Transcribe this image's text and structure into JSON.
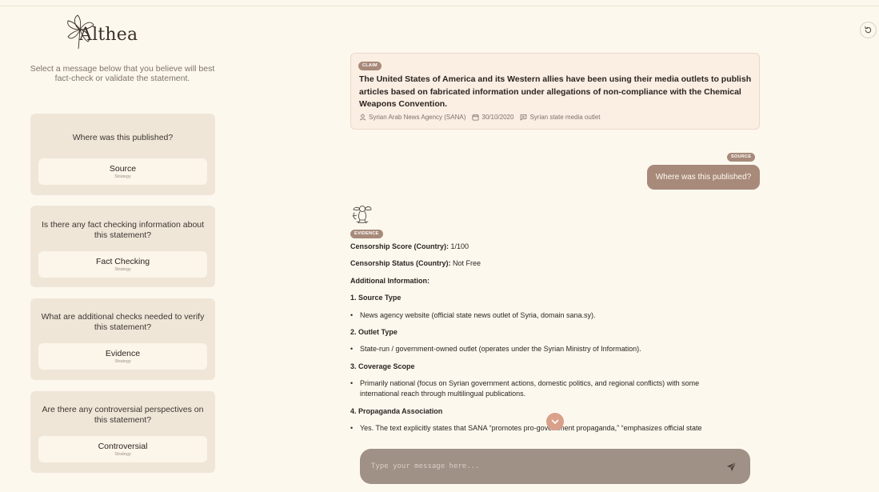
{
  "app": {
    "name": "Althea"
  },
  "sidebar": {
    "instructions": "Select a message below that you believe will best fact-check or validate the statement.",
    "cards": [
      {
        "question": "Where was this published?",
        "button_label": "Source",
        "button_sub": "Strategy"
      },
      {
        "question": "Is there any fact checking information about this statement?",
        "button_label": "Fact Checking",
        "button_sub": "Strategy"
      },
      {
        "question": "What are additional checks needed to verify this statement?",
        "button_label": "Evidence",
        "button_sub": "Strategy"
      },
      {
        "question": "Are there any controversial perspectives on this statement?",
        "button_label": "Controversial",
        "button_sub": "Strategy"
      }
    ]
  },
  "claim": {
    "tag": "CLAIM",
    "text": "The United States of America and its Western allies have been using their media outlets to publish articles based on fabricated information under allegations of non-compliance with the Chemical Weapons Convention.",
    "author": "Syrian Arab News Agency (SANA)",
    "date": "30/10/2020",
    "outlet": "Syrian state media outlet"
  },
  "chat": {
    "user_tag": "SOURCE",
    "user_message": "Where was this published?",
    "bot_tag": "EVIDENCE",
    "response": {
      "censorship_score_label": "Censorship Score (Country):",
      "censorship_score_value": " 1/100",
      "censorship_status_label": "Censorship Status (Country):",
      "censorship_status_value": " Not Free",
      "additional_info": "Additional Information:",
      "sections": [
        {
          "heading": "1. Source Type",
          "lines": [
            "News agency website (official state news outlet of Syria, domain sana.sy)."
          ]
        },
        {
          "heading": "2. Outlet Type",
          "lines": [
            "State-run / government-owned outlet (operates under the Syrian Ministry of Information)."
          ]
        },
        {
          "heading": "3. Coverage Scope",
          "lines": [
            "Primarily national (focus on Syrian government actions, domestic politics, and regional conflicts) with some",
            "international reach through multilingual publications."
          ]
        },
        {
          "heading": "4. Propaganda Association",
          "lines": [
            "Yes. The text explicitly states that SANA “promotes pro-government propaganda,” “emphasizes official state"
          ]
        }
      ]
    }
  },
  "input": {
    "placeholder": "Type your message here..."
  },
  "icons": {
    "reset": "refresh-icon",
    "author": "person-icon",
    "date": "calendar-icon",
    "outlet": "message-square-icon",
    "scroll": "chevron-down-icon",
    "send": "send-icon"
  },
  "colors": {
    "background": "#fdf8ee",
    "card": "#efe6d8",
    "accent": "#a88a7a",
    "claim_bg": "#fbeee3",
    "scroll_button": "#d9a08a",
    "input_bar": "#a09186"
  }
}
